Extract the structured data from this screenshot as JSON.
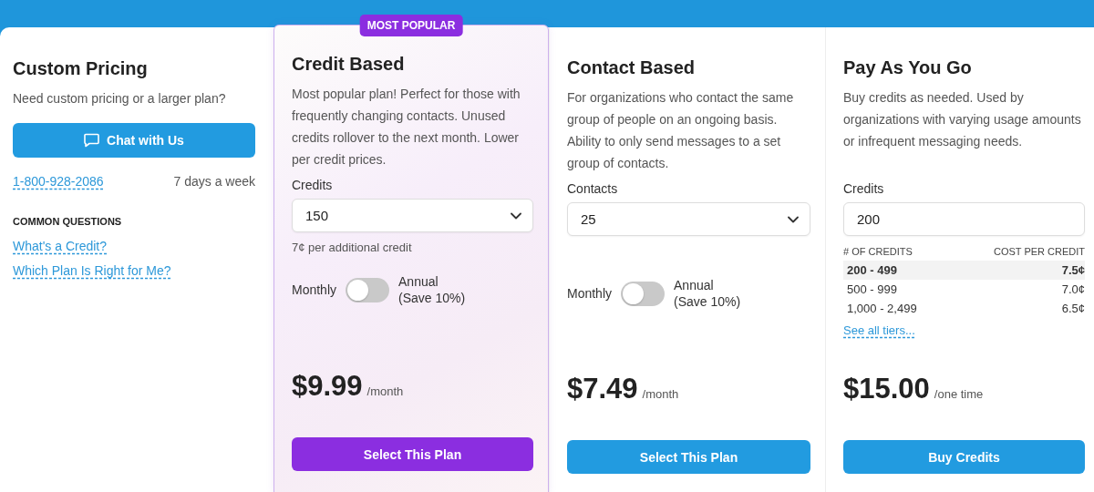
{
  "custom": {
    "title": "Custom Pricing",
    "description": "Need custom pricing or a larger plan?",
    "button": "Chat with Us",
    "phone": "1-800-928-2086",
    "hours": "7 days a week",
    "questions_heading": "COMMON QUESTIONS",
    "links": [
      "What's a Credit?",
      "Which Plan Is Right for Me?"
    ]
  },
  "plans": [
    {
      "kind": "toggle",
      "featured": true,
      "badge": "MOST POPULAR",
      "title": "Credit Based",
      "description": "Most popular plan! Perfect for those with frequently changing contacts. Unused credits rollover to the next month. Lower per credit prices.",
      "field": {
        "kind": "select",
        "label": "Credits",
        "value": "150"
      },
      "note": "7¢ per additional credit",
      "toggle": {
        "left": "Monthly",
        "right": "Annual (Save 10%)",
        "on": false
      },
      "price": "$9.99",
      "period": "/month",
      "button": "Select This Plan"
    },
    {
      "kind": "toggle",
      "featured": false,
      "title": "Contact Based",
      "description": "For organizations who contact the same group of people on an ongoing basis. Ability to only send messages to a set group of contacts.",
      "field": {
        "kind": "select",
        "label": "Contacts",
        "value": "25"
      },
      "toggle": {
        "left": "Monthly",
        "right": "Annual (Save 10%)",
        "on": false
      },
      "price": "$7.49",
      "period": "/month",
      "button": "Select This Plan"
    },
    {
      "kind": "tiers",
      "featured": false,
      "title": "Pay As You Go",
      "description": "Buy credits as needed. Used by organizations with varying usage amounts or infrequent messaging needs.",
      "field": {
        "kind": "input",
        "label": "Credits",
        "value": "200"
      },
      "tiers": {
        "columns": [
          "# OF CREDITS",
          "COST PER CREDIT"
        ],
        "rows": [
          {
            "range": "200 - 499",
            "cost": "7.5¢",
            "selected": true
          },
          {
            "range": "500 - 999",
            "cost": "7.0¢",
            "selected": false
          },
          {
            "range": "1,000 - 2,499",
            "cost": "6.5¢",
            "selected": false
          }
        ],
        "link": "See all tiers..."
      },
      "price": "$15.00",
      "period": "/one time",
      "button": "Buy Credits"
    }
  ]
}
